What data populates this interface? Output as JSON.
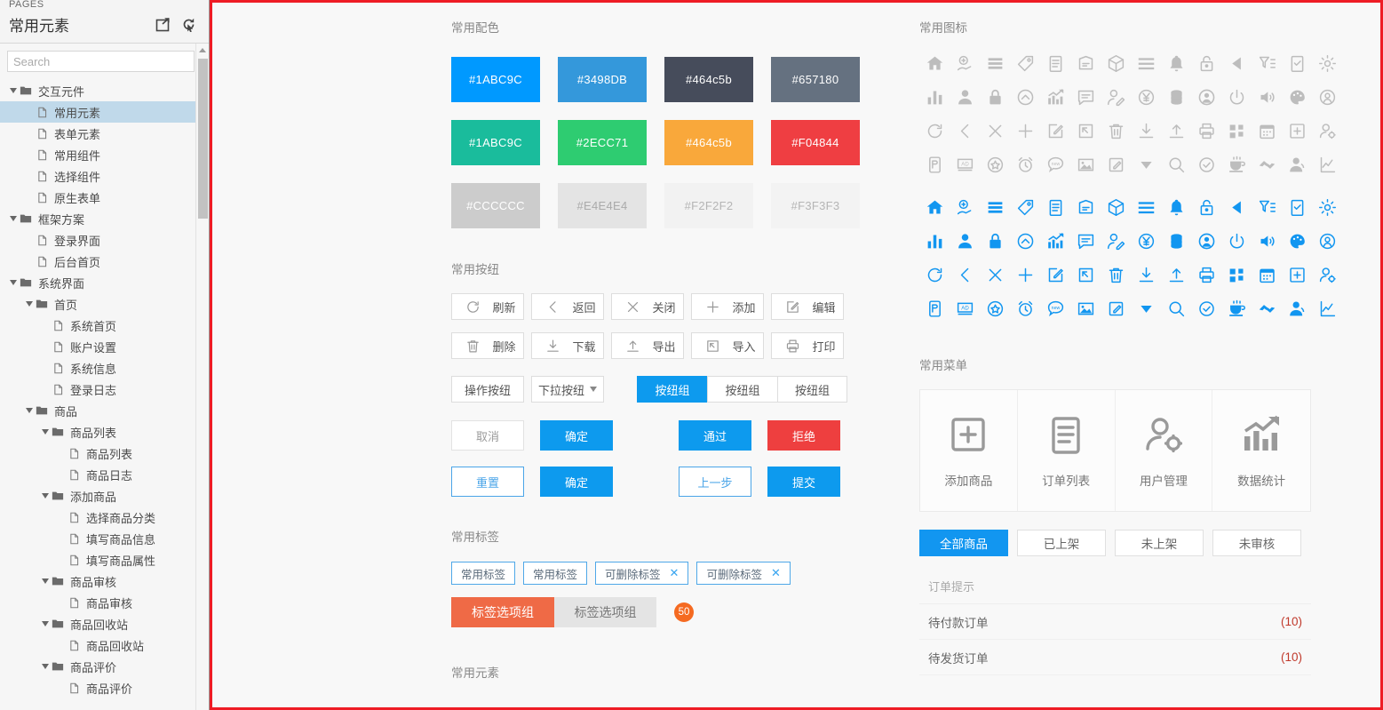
{
  "sidebar": {
    "pages_label": "PAGES",
    "title": "常用元素",
    "icons": [
      {
        "name": "open-in-new-window-icon"
      },
      {
        "name": "reload-pointer-icon"
      }
    ],
    "search_placeholder": "Search",
    "tree": [
      {
        "label": "交互元件",
        "type": "folder",
        "depth": 0,
        "expanded": true,
        "selected": false
      },
      {
        "label": "常用元素",
        "type": "page",
        "depth": 1,
        "selected": true
      },
      {
        "label": "表单元素",
        "type": "page",
        "depth": 1,
        "selected": false
      },
      {
        "label": "常用组件",
        "type": "page",
        "depth": 1,
        "selected": false
      },
      {
        "label": "选择组件",
        "type": "page",
        "depth": 1,
        "selected": false
      },
      {
        "label": "原生表单",
        "type": "page",
        "depth": 1,
        "selected": false
      },
      {
        "label": "框架方案",
        "type": "folder",
        "depth": 0,
        "expanded": true,
        "selected": false
      },
      {
        "label": "登录界面",
        "type": "page",
        "depth": 1,
        "selected": false
      },
      {
        "label": "后台首页",
        "type": "page",
        "depth": 1,
        "selected": false
      },
      {
        "label": "系统界面",
        "type": "folder",
        "depth": 0,
        "expanded": true,
        "selected": false
      },
      {
        "label": "首页",
        "type": "folder",
        "depth": 1,
        "expanded": true,
        "selected": false
      },
      {
        "label": "系统首页",
        "type": "page",
        "depth": 2,
        "selected": false
      },
      {
        "label": "账户设置",
        "type": "page",
        "depth": 2,
        "selected": false
      },
      {
        "label": "系统信息",
        "type": "page",
        "depth": 2,
        "selected": false
      },
      {
        "label": "登录日志",
        "type": "page",
        "depth": 2,
        "selected": false
      },
      {
        "label": "商品",
        "type": "folder",
        "depth": 1,
        "expanded": true,
        "selected": false
      },
      {
        "label": "商品列表",
        "type": "folder",
        "depth": 2,
        "expanded": true,
        "selected": false
      },
      {
        "label": "商品列表",
        "type": "page",
        "depth": 3,
        "selected": false
      },
      {
        "label": "商品日志",
        "type": "page",
        "depth": 3,
        "selected": false
      },
      {
        "label": "添加商品",
        "type": "folder",
        "depth": 2,
        "expanded": true,
        "selected": false
      },
      {
        "label": "选择商品分类",
        "type": "page",
        "depth": 3,
        "selected": false
      },
      {
        "label": "填写商品信息",
        "type": "page",
        "depth": 3,
        "selected": false
      },
      {
        "label": "填写商品属性",
        "type": "page",
        "depth": 3,
        "selected": false
      },
      {
        "label": "商品审核",
        "type": "folder",
        "depth": 2,
        "expanded": true,
        "selected": false
      },
      {
        "label": "商品审核",
        "type": "page",
        "depth": 3,
        "selected": false
      },
      {
        "label": "商品回收站",
        "type": "folder",
        "depth": 2,
        "expanded": true,
        "selected": false
      },
      {
        "label": "商品回收站",
        "type": "page",
        "depth": 3,
        "selected": false
      },
      {
        "label": "商品评价",
        "type": "folder",
        "depth": 2,
        "expanded": true,
        "selected": false
      },
      {
        "label": "商品评价",
        "type": "page",
        "depth": 3,
        "selected": false
      }
    ]
  },
  "canvas": {
    "colors_section": {
      "title": "常用配色",
      "swatches": [
        {
          "label": "#1ABC9C",
          "fill": "#0099ff",
          "text": "#ffffff"
        },
        {
          "label": "#3498DB",
          "fill": "#3498db",
          "text": "#ffffff"
        },
        {
          "label": "#464c5b",
          "fill": "#464c5b",
          "text": "#ffffff"
        },
        {
          "label": "#657180",
          "fill": "#657180",
          "text": "#ffffff"
        },
        {
          "label": "#1ABC9C",
          "fill": "#1abc9c",
          "text": "#ffffff"
        },
        {
          "label": "#2ECC71",
          "fill": "#2ecc71",
          "text": "#ffffff"
        },
        {
          "label": "#464c5b",
          "fill": "#f9a83b",
          "text": "#ffffff"
        },
        {
          "label": "#F04844",
          "fill": "#ef3e42",
          "text": "#ffffff"
        },
        {
          "label": "#CCCCCC",
          "fill": "#cccccc",
          "text": "#ffffff"
        },
        {
          "label": "#E4E4E4",
          "fill": "#e4e4e4",
          "text": "#aaaaaa"
        },
        {
          "label": "#F2F2F2",
          "fill": "#f2f2f2",
          "text": "#b5b5b5"
        },
        {
          "label": "#F3F3F3",
          "fill": "#f3f3f3",
          "text": "#b5b5b5"
        }
      ]
    },
    "buttons_section": {
      "title": "常用按纽",
      "icon_buttons_row1": [
        {
          "label": "刷新",
          "icon": "refresh-icon"
        },
        {
          "label": "返回",
          "icon": "chevron-left-icon"
        },
        {
          "label": "关闭",
          "icon": "close-icon"
        },
        {
          "label": "添加",
          "icon": "plus-icon"
        },
        {
          "label": "编辑",
          "icon": "edit-icon"
        }
      ],
      "icon_buttons_row2": [
        {
          "label": "删除",
          "icon": "trash-icon"
        },
        {
          "label": "下载",
          "icon": "download-icon"
        },
        {
          "label": "导出",
          "icon": "upload-icon"
        },
        {
          "label": "导入",
          "icon": "import-icon"
        },
        {
          "label": "打印",
          "icon": "printer-icon"
        }
      ],
      "action_button": "操作按纽",
      "dropdown_button": "下拉按纽",
      "button_group": [
        "按纽组",
        "按纽组",
        "按纽组"
      ],
      "button_group_active_index": 0,
      "row_confirm": [
        {
          "label": "取消",
          "style": "cancel"
        },
        {
          "label": "确定",
          "style": "primary"
        },
        {
          "label": "通过",
          "style": "primary"
        },
        {
          "label": "拒绝",
          "style": "danger"
        }
      ],
      "row_submit": [
        {
          "label": "重置",
          "style": "ghost-blue"
        },
        {
          "label": "确定",
          "style": "primary"
        },
        {
          "label": "上一步",
          "style": "ghost-blue"
        },
        {
          "label": "提交",
          "style": "primary"
        }
      ]
    },
    "tags_section": {
      "title": "常用标签",
      "tags": [
        {
          "label": "常用标签",
          "closable": false
        },
        {
          "label": "常用标签",
          "closable": false
        },
        {
          "label": "可删除标签",
          "closable": true
        },
        {
          "label": "可删除标签",
          "closable": true
        }
      ],
      "option_group": [
        {
          "label": "标签选项组",
          "active": true
        },
        {
          "label": "标签选项组",
          "active": false
        }
      ],
      "badge": "50"
    },
    "bottom_section_title": "常用元素",
    "icons_section": {
      "title": "常用图标",
      "gray_color": "#bdbdbd",
      "blue_color": "#1296f0",
      "rows": [
        [
          "home-icon",
          "money-hand-icon",
          "list-stack-icon",
          "tag-icon",
          "clipboard-icon",
          "folder-note-icon",
          "box-icon",
          "menu-bars-icon",
          "bell-icon",
          "unlock-icon",
          "play-left-icon",
          "filter-list-icon",
          "clipboard-check-icon",
          "gear-icon"
        ],
        [
          "bar-chart-icon",
          "user-icon",
          "lock-icon",
          "cloud-up-icon",
          "trend-chart-icon",
          "comment-icon",
          "user-edit-icon",
          "yen-circle-icon",
          "coins-icon",
          "user-circle-icon",
          "power-icon",
          "volume-icon",
          "palette-icon",
          "user-badge-icon"
        ],
        [
          "refresh-icon",
          "chevron-left-icon",
          "close-icon",
          "plus-icon",
          "edit-icon",
          "import-icon",
          "trash-icon",
          "download-icon",
          "upload-icon",
          "printer-icon",
          "grid-apps-icon",
          "calendar-icon",
          "plus-box-icon",
          "user-settings-icon"
        ],
        [
          "mobile-pay-icon",
          "ad-icon",
          "star-circle-icon",
          "alarm-clock-icon",
          "new-badge-icon",
          "image-icon",
          "note-edit-icon",
          "caret-down-icon",
          "search-icon",
          "check-circle-icon",
          "coffee-icon",
          "handshake-icon",
          "person-icon",
          "line-chart-icon"
        ]
      ]
    },
    "menu_section": {
      "title": "常用菜单",
      "cards": [
        {
          "label": "添加商品",
          "icon": "plus-box-icon"
        },
        {
          "label": "订单列表",
          "icon": "clipboard-icon"
        },
        {
          "label": "用户管理",
          "icon": "user-settings-icon"
        },
        {
          "label": "数据统计",
          "icon": "trend-chart-icon"
        }
      ],
      "filters": [
        {
          "label": "全部商品",
          "active": true
        },
        {
          "label": "已上架",
          "active": false
        },
        {
          "label": "未上架",
          "active": false
        },
        {
          "label": "未审核",
          "active": false
        }
      ],
      "order_list_header": "订单提示",
      "order_rows": [
        {
          "label": "待付款订单",
          "count": "(10)"
        },
        {
          "label": "待发货订单",
          "count": "(10)"
        }
      ]
    }
  }
}
